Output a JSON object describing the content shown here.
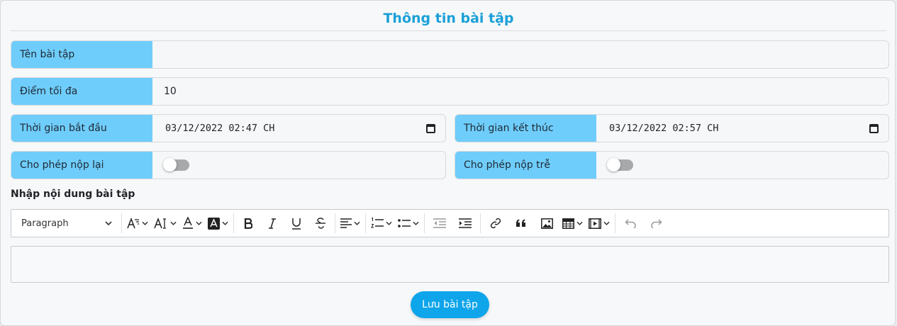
{
  "form": {
    "title": "Thông tin bài tập",
    "name_label": "Tên bài tập",
    "name_value": "",
    "max_score_label": "Điểm tối đa",
    "max_score_value": "10",
    "start_label": "Thời gian bắt đầu",
    "start_value": "03/12/2022 02:47 CH",
    "end_label": "Thời gian kết thúc",
    "end_value": "03/12/2022 02:57 CH",
    "resubmit_label": "Cho phép nộp lại",
    "resubmit_on": false,
    "late_label": "Cho phép nộp trễ",
    "late_on": false,
    "content_label": "Nhập nội dung bài tập",
    "save_label": "Lưu bài tập"
  },
  "toolbar": {
    "heading_select": "Paragraph",
    "buttons": [
      "font-size",
      "font-family",
      "font-color",
      "background-color",
      "bold",
      "italic",
      "underline",
      "strikethrough",
      "alignment",
      "numbered-list",
      "bulleted-list",
      "outdent",
      "indent",
      "link",
      "block-quote",
      "insert-image",
      "insert-table",
      "insert-media",
      "undo",
      "redo"
    ]
  },
  "colors": {
    "accent": "#1ba0d8",
    "label_bg": "#6fcdfb",
    "button": "#0ea5ea"
  }
}
